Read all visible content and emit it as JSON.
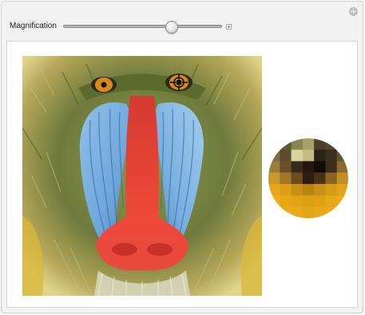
{
  "controls": {
    "magnification_label": "Magnification",
    "slider_level": 0.7,
    "increment_icon": "plus-icon",
    "corner_icon": "add-circle-icon"
  },
  "image": {
    "subject_icon": "mandrill-face-image",
    "crosshair_icon": "crosshair-icon"
  },
  "magnifier": {
    "shape": "circle",
    "pixel_grid": [
      [
        "#6a6a3a",
        "#5a5a34",
        "#8a8450",
        "#a8a064",
        "#4a4028",
        "#52482c",
        "#6e6638"
      ],
      [
        "#7a6e44",
        "#5c4c30",
        "#d8d49a",
        "#c4bc80",
        "#2a2418",
        "#3a3020",
        "#5c5432"
      ],
      [
        "#9a7c3c",
        "#6a5028",
        "#3a2a1c",
        "#24180e",
        "#140c08",
        "#3c2c18",
        "#8a6a30"
      ],
      [
        "#c89a28",
        "#a07828",
        "#6a4c20",
        "#2e1e10",
        "#4a3214",
        "#8a6420",
        "#c09024"
      ],
      [
        "#e6a818",
        "#dca014",
        "#c89014",
        "#b88410",
        "#c89014",
        "#d89c14",
        "#e2a416"
      ],
      [
        "#eeae1a",
        "#e8a816",
        "#e2a414",
        "#dca012",
        "#e0a214",
        "#e6a816",
        "#eaac18"
      ],
      [
        "#f0b01c",
        "#ecac1a",
        "#e8aa18",
        "#e4a616",
        "#e8aa18",
        "#ecac1a",
        "#f0b01c"
      ]
    ]
  }
}
